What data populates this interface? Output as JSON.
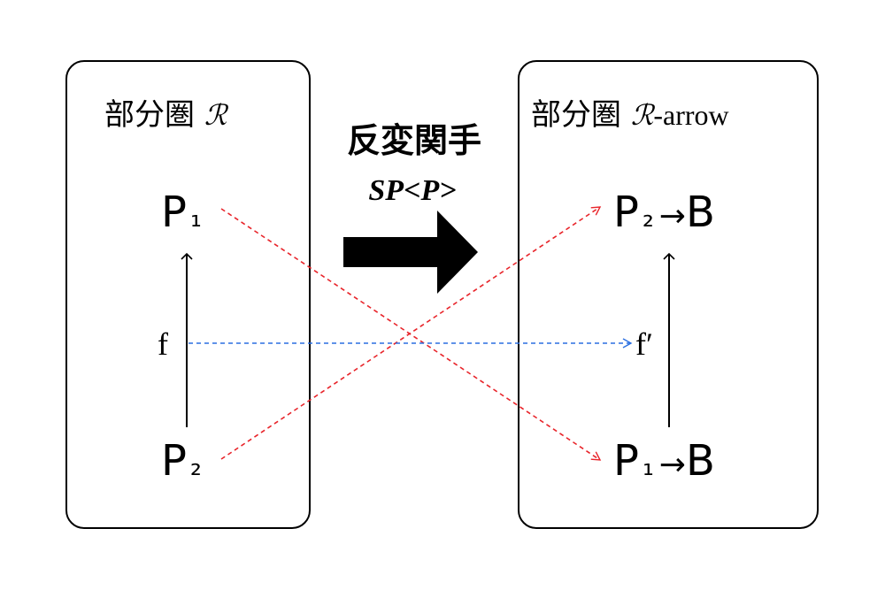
{
  "left_panel": {
    "title": "部分圏 ",
    "title_symbol": "ℛ",
    "top_node": {
      "base": "P",
      "subscript": "₁"
    },
    "bottom_node": {
      "base": "P",
      "subscript": "₂"
    },
    "morphism_label": "f"
  },
  "functor": {
    "title": "反変関手",
    "subtitle": "SP<P>"
  },
  "right_panel": {
    "title": "部分圏 ",
    "title_symbol": "ℛ",
    "title_suffix": "-arrow",
    "top_node": {
      "base": "P",
      "subscript": "₂",
      "arrow": "→",
      "target": "B"
    },
    "bottom_node": {
      "base": "P",
      "subscript": "₁",
      "arrow": "→",
      "target": "B"
    },
    "morphism_label": "f′"
  },
  "colors": {
    "object_map": "#e8242a",
    "morphism_map": "#2a6fe0",
    "frame": "#000000"
  }
}
